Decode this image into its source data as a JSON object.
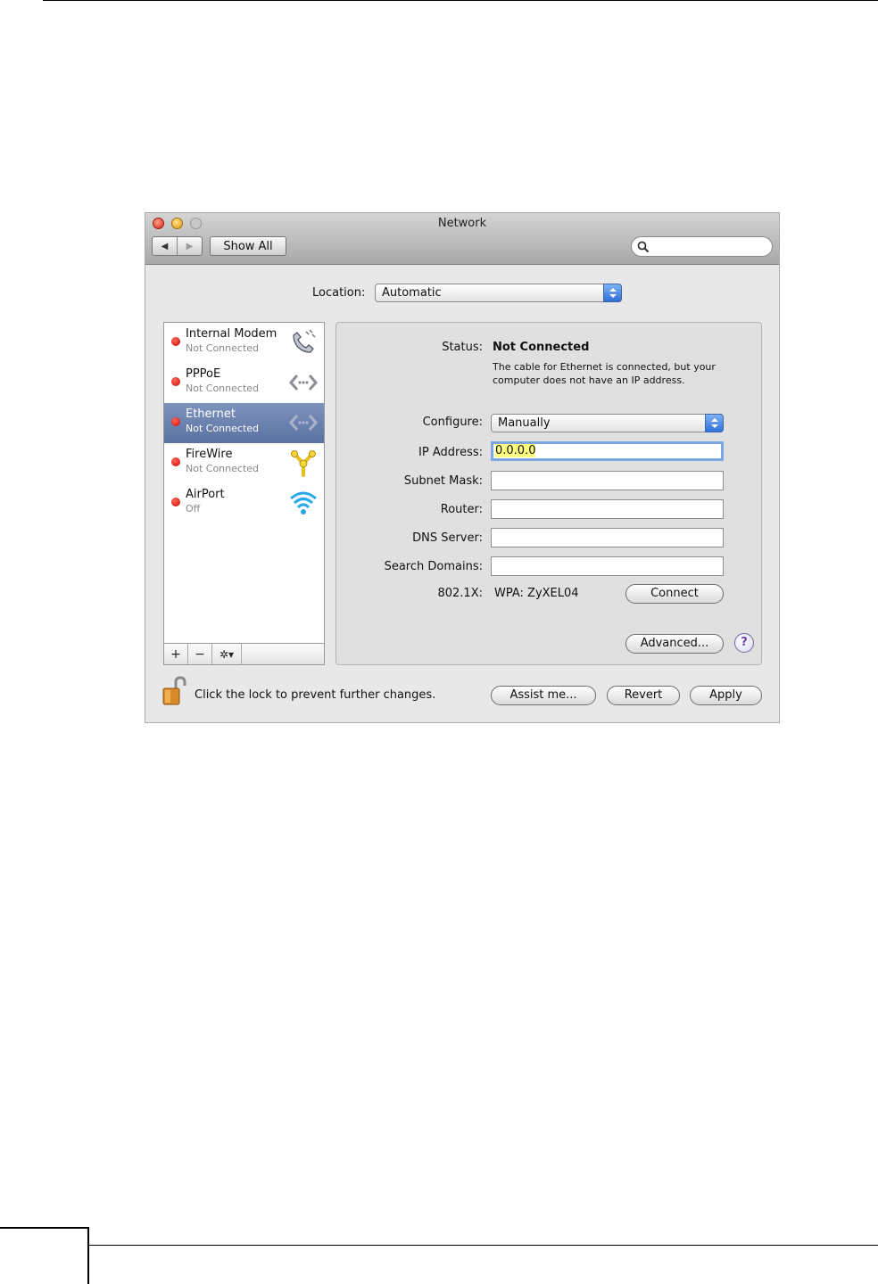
{
  "window": {
    "title": "Network"
  },
  "toolbar": {
    "back_label": "◀",
    "forward_label": "▶",
    "show_all_label": "Show All",
    "search_placeholder": ""
  },
  "location": {
    "label": "Location:",
    "value": "Automatic"
  },
  "services": [
    {
      "name": "Internal Modem",
      "status": "Not Connected",
      "icon": "modem-phone-icon",
      "selected": false
    },
    {
      "name": "PPPoE",
      "status": "Not Connected",
      "icon": "ethernet-arrows-icon",
      "selected": false
    },
    {
      "name": "Ethernet",
      "status": "Not Connected",
      "icon": "ethernet-arrows-icon",
      "selected": true
    },
    {
      "name": "FireWire",
      "status": "Not Connected",
      "icon": "firewire-icon",
      "selected": false
    },
    {
      "name": "AirPort",
      "status": "Off",
      "icon": "wifi-icon",
      "selected": false
    }
  ],
  "list_tools": {
    "add": "+",
    "remove": "−",
    "gear": "✲▾"
  },
  "detail": {
    "status_label": "Status:",
    "status_value": "Not Connected",
    "status_desc": "The cable for Ethernet is connected, but your computer does not have an IP address.",
    "configure_label": "Configure:",
    "configure_value": "Manually",
    "ip_label": "IP Address:",
    "ip_value": "0.0.0.0",
    "subnet_label": "Subnet Mask:",
    "subnet_value": "",
    "router_label": "Router:",
    "router_value": "",
    "dns_label": "DNS Server:",
    "dns_value": "",
    "search_domains_label": "Search Domains:",
    "search_domains_value": "",
    "dot1x_label": "802.1X:",
    "dot1x_value": "WPA: ZyXEL04",
    "connect_label": "Connect",
    "advanced_label": "Advanced...",
    "help_label": "?"
  },
  "footer": {
    "lock_text": "Click the lock to prevent further changes.",
    "assist_label": "Assist me...",
    "revert_label": "Revert",
    "apply_label": "Apply"
  },
  "colors": {
    "selection": "#5b71a1",
    "status_dot": "#cc0000",
    "popup_arrows": "#2f6fd8"
  }
}
